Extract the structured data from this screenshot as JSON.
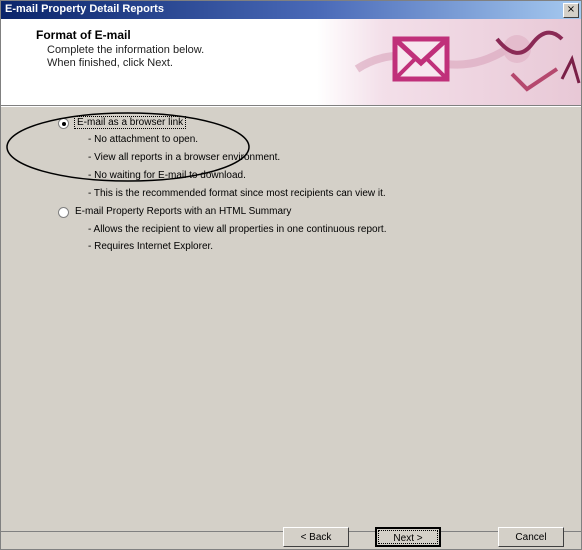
{
  "window": {
    "title": "E-mail Property Detail Reports",
    "close_glyph": "×"
  },
  "header": {
    "title": "Format of E-mail",
    "subtitle_line1": "Complete the information below.",
    "subtitle_line2": "When finished, click Next."
  },
  "options": [
    {
      "label": "E-mail as a browser link",
      "selected": true,
      "details": [
        "- No attachment to open.",
        "- View all reports in a browser environment.",
        "- No waiting for E-mail to download.",
        "- This is the recommended format since most recipients can view it."
      ]
    },
    {
      "label": "E-mail Property Reports with an HTML Summary",
      "selected": false,
      "details": [
        "- Allows the recipient to view all properties in one continuous report.",
        "- Requires Internet Explorer."
      ]
    }
  ],
  "buttons": {
    "back": "< Back",
    "next": "Next >",
    "cancel": "Cancel"
  },
  "colors": {
    "titlebar_start": "#0a246a",
    "titlebar_end": "#a6caf0",
    "dialog_face": "#d4d0c8",
    "envelope_art": "#c0307a"
  }
}
